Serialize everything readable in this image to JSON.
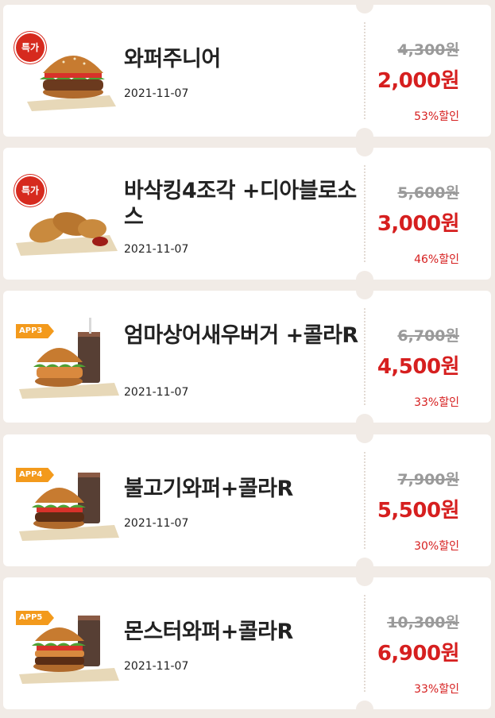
{
  "coupons": [
    {
      "badge": "특가",
      "badge_type": "special",
      "image": "burger-icon",
      "title": "와퍼주니어",
      "date": "2021-11-07",
      "original_price": "4,300원",
      "sale_price": "2,000원",
      "discount": "53%할인"
    },
    {
      "badge": "특가",
      "badge_type": "special",
      "image": "chicken-icon",
      "title": "바삭킹4조각 +디아블로소스",
      "date": "2021-11-07",
      "original_price": "5,600원",
      "sale_price": "3,000원",
      "discount": "46%할인"
    },
    {
      "badge": "APP3",
      "badge_type": "app",
      "image": "burger-cola-icon",
      "title": "엄마상어새우버거 +콜라R",
      "date": "2021-11-07",
      "original_price": "6,700원",
      "sale_price": "4,500원",
      "discount": "33%할인"
    },
    {
      "badge": "APP4",
      "badge_type": "app",
      "image": "burger-cola-icon",
      "title": "불고기와퍼+콜라R",
      "date": "2021-11-07",
      "original_price": "7,900원",
      "sale_price": "5,500원",
      "discount": "30%할인"
    },
    {
      "badge": "APP5",
      "badge_type": "app",
      "image": "burger-cola-icon",
      "title": "몬스터와퍼+콜라R",
      "date": "2021-11-07",
      "original_price": "10,300원",
      "sale_price": "6,900원",
      "discount": "33%할인"
    }
  ],
  "colors": {
    "accent": "#d61f1f",
    "special_badge": "#d62a1e",
    "app_badge": "#f39a1c",
    "background": "#f1ebe6"
  }
}
